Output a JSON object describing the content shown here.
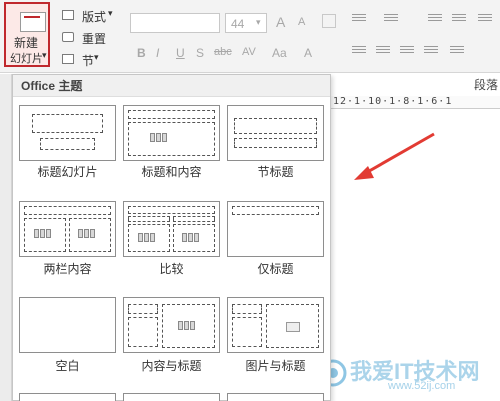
{
  "ribbon": {
    "new_slide_line1": "新建",
    "new_slide_line2": "幻灯片",
    "new_slide_arrow": "▾",
    "layout_label": "版式",
    "layout_arrow": "▾",
    "reset_label": "重置",
    "section_label": "节",
    "section_arrow": "▾",
    "font_size": "44",
    "font_size_arrow": "▾",
    "grow_font": "A",
    "shrink_font": "A",
    "bold": "B",
    "italic": "I",
    "underline": "U",
    "shadow": "S",
    "strike": "abc",
    "spacing": "AV",
    "change_case": "Aa",
    "font_color": "A",
    "paragraph_group_label": "段落"
  },
  "gallery": {
    "header": "Office 主题",
    "layouts": [
      {
        "label": "标题幻灯片"
      },
      {
        "label": "标题和内容"
      },
      {
        "label": "节标题"
      },
      {
        "label": "两栏内容"
      },
      {
        "label": "比较"
      },
      {
        "label": "仅标题"
      },
      {
        "label": "空白"
      },
      {
        "label": "内容与标题"
      },
      {
        "label": "图片与标题"
      }
    ]
  },
  "ruler": {
    "ticks": "12·1·10·1·8·1·6·1"
  },
  "watermark": {
    "text": "我爱IT技术网",
    "url": "www.52ij.com"
  },
  "colors": {
    "highlight": "#c0282d",
    "arrow": "#e23b33"
  }
}
